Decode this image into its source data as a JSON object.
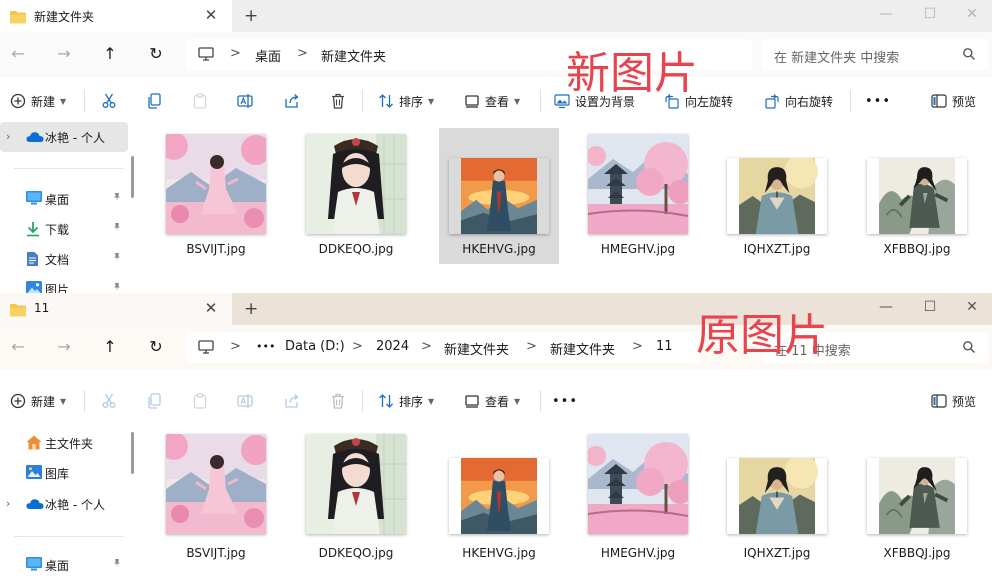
{
  "overlays": {
    "top": "新图片",
    "bottom": "原图片"
  },
  "window1": {
    "tab_title": "新建文件夹",
    "tab_close": "✕",
    "new_tab": "+",
    "controls": {
      "min": "—",
      "max": "☐",
      "close": "✕"
    },
    "nav": {
      "back": "←",
      "forward": "→",
      "up": "↑",
      "refresh": "↻"
    },
    "breadcrumb": [
      "桌面",
      "新建文件夹"
    ],
    "breadcrumb_sep": ">",
    "search_placeholder": "在 新建文件夹 中搜索",
    "cmd": {
      "new": "新建",
      "sort": "排序",
      "view": "查看",
      "set_bg": "设置为背景",
      "rotate_left": "向左旋转",
      "rotate_right": "向右旋转",
      "more": "•••",
      "preview": "预览"
    },
    "sidebar": [
      {
        "label": "冰艳 - 个人",
        "icon": "onedrive-cloud-icon"
      },
      {
        "label": "桌面",
        "icon": "desktop-icon",
        "pinned": true
      },
      {
        "label": "下载",
        "icon": "download-icon",
        "pinned": true
      },
      {
        "label": "文档",
        "icon": "document-icon",
        "pinned": true
      },
      {
        "label": "图片",
        "icon": "pictures-icon",
        "pinned": true
      }
    ],
    "files": [
      {
        "name": "BSVIJT.jpg"
      },
      {
        "name": "DDKEQO.jpg"
      },
      {
        "name": "HKEHVG.jpg",
        "selected": true
      },
      {
        "name": "HMEGHV.jpg"
      },
      {
        "name": "IQHXZT.jpg"
      },
      {
        "name": "XFBBQJ.jpg"
      }
    ]
  },
  "window2": {
    "tab_title": "11",
    "tab_close": "✕",
    "new_tab": "+",
    "controls": {
      "min": "—",
      "max": "☐",
      "close": "✕"
    },
    "nav": {
      "back": "←",
      "forward": "→",
      "up": "↑",
      "refresh": "↻"
    },
    "breadcrumb": [
      "•••",
      "Data (D:)",
      "2024",
      "新建文件夹",
      "新建文件夹",
      "11"
    ],
    "breadcrumb_sep": ">",
    "search_placeholder": "在 11 中搜索",
    "cmd": {
      "new": "新建",
      "sort": "排序",
      "view": "查看",
      "more": "•••",
      "preview": "预览"
    },
    "sidebar": [
      {
        "label": "主文件夹",
        "icon": "home-icon"
      },
      {
        "label": "图库",
        "icon": "gallery-icon"
      },
      {
        "label": "冰艳 - 个人",
        "icon": "onedrive-cloud-icon"
      },
      {
        "label": "桌面",
        "icon": "desktop-icon",
        "pinned": true
      }
    ],
    "files": [
      {
        "name": "BSVIJT.jpg"
      },
      {
        "name": "DDKEQO.jpg"
      },
      {
        "name": "HKEHVG.jpg"
      },
      {
        "name": "HMEGHV.jpg"
      },
      {
        "name": "IQHXZT.jpg"
      },
      {
        "name": "XFBBQJ.jpg"
      }
    ]
  },
  "colors": {
    "overlay_text": "#e8444e",
    "selection": "#dadada",
    "accent": "#0067c0"
  }
}
